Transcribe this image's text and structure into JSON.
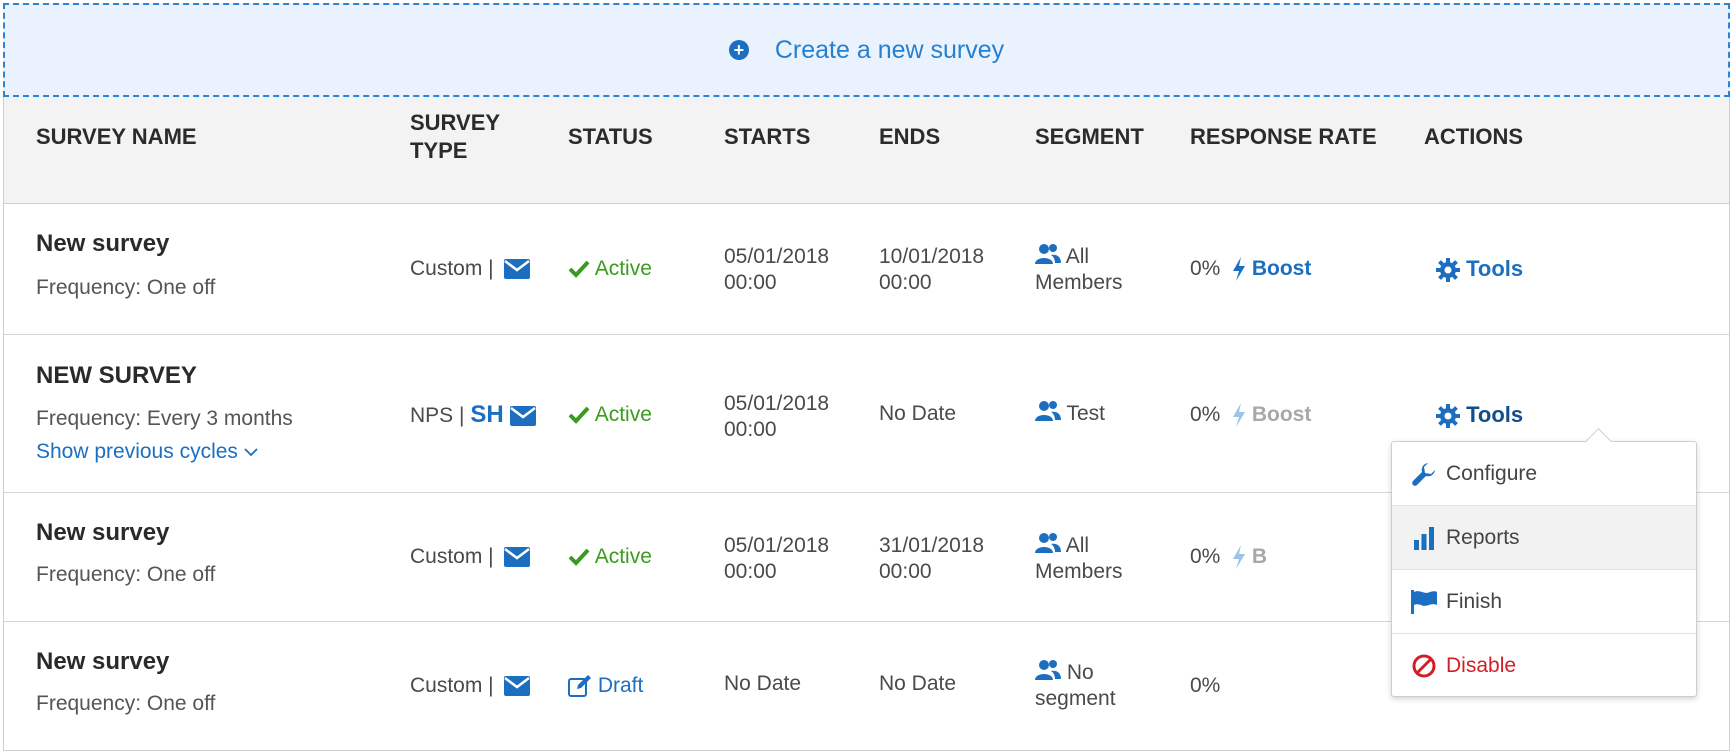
{
  "create": {
    "label": "Create a new survey"
  },
  "columns": {
    "name": "SURVEY NAME",
    "type_line1": "SURVEY",
    "type_line2": "TYPE",
    "status": "STATUS",
    "starts": "STARTS",
    "ends": "ENDS",
    "segment": "SEGMENT",
    "response": "RESPONSE RATE",
    "actions": "ACTIONS"
  },
  "rows": [
    {
      "name": "New survey",
      "frequency": "Frequency: One off",
      "type": "Custom |",
      "status": "Active",
      "starts_date": "05/01/2018",
      "starts_time": "00:00",
      "ends_date": "10/01/2018",
      "ends_time": "00:00",
      "segment_line1": "All",
      "segment_line2": "Members",
      "rate": "0%",
      "boost": "Boost",
      "tools": "Tools"
    },
    {
      "name": "NEW SURVEY",
      "frequency": "Frequency: Every 3 months",
      "show_cycles": "Show previous cycles",
      "type": "NPS |",
      "type_badge": "SH",
      "status": "Active",
      "starts_date": "05/01/2018",
      "starts_time": "00:00",
      "ends": "No Date",
      "segment_line1": "Test",
      "rate": "0%",
      "boost": "Boost",
      "tools": "Tools"
    },
    {
      "name": "New survey",
      "frequency": "Frequency: One off",
      "type": "Custom |",
      "status": "Active",
      "starts_date": "05/01/2018",
      "starts_time": "00:00",
      "ends_date": "31/01/2018",
      "ends_time": "00:00",
      "segment_line1": "All",
      "segment_line2": "Members",
      "rate": "0%",
      "boost_partial": "B"
    },
    {
      "name": "New survey",
      "frequency": "Frequency: One off",
      "type": "Custom |",
      "status": "Draft",
      "starts": "No Date",
      "ends": "No Date",
      "segment_line1": "No",
      "segment_line2": "segment",
      "rate": "0%"
    }
  ],
  "tools_menu": {
    "items": [
      {
        "label": "Configure",
        "icon": "wrench-icon"
      },
      {
        "label": "Reports",
        "icon": "bar-chart-icon"
      },
      {
        "label": "Finish",
        "icon": "flag-icon"
      },
      {
        "label": "Disable",
        "icon": "ban-icon"
      }
    ]
  },
  "colors": {
    "accent": "#1c6fc0",
    "success": "#3a9c1e",
    "danger": "#d21f26",
    "header_bg": "#f3f3f3",
    "create_bg": "#eaf3fd"
  }
}
